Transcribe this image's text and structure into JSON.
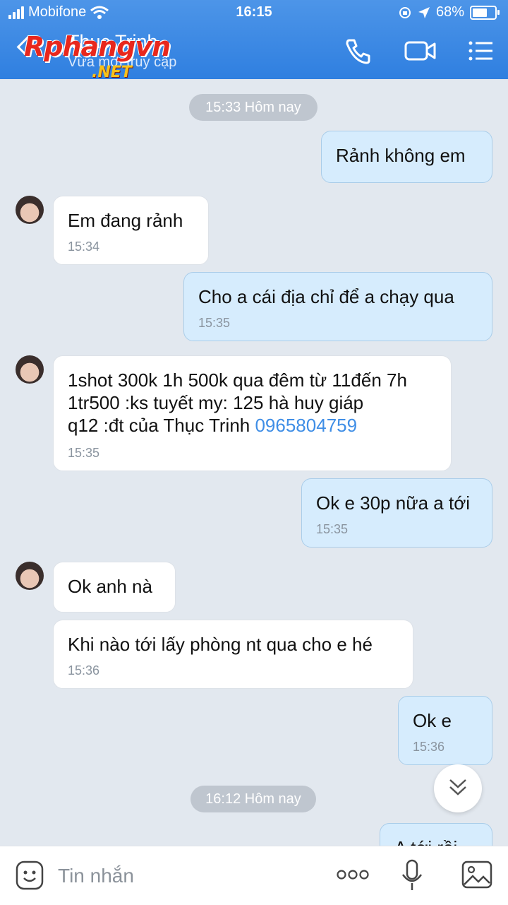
{
  "status_bar": {
    "carrier": "Mobifone",
    "time": "16:15",
    "battery": "68%"
  },
  "header": {
    "contact_name": "Thục Trinh",
    "presence": "Vừa mới truy cập",
    "watermark_main": "Rphangvn",
    "watermark_sub": ".NET"
  },
  "icons": {
    "back": "chevron-left-icon",
    "call": "phone-icon",
    "video": "video-call-icon",
    "menu": "list-menu-icon",
    "sticker": "emoji-icon",
    "more": "more-dots-icon",
    "mic": "microphone-icon",
    "image": "image-icon",
    "scroll": "double-chevron-down-icon"
  },
  "chat": {
    "date1": "15:33 Hôm nay",
    "date2": "16:12 Hôm nay",
    "m1": {
      "text": "Rảnh không em"
    },
    "m2": {
      "text": "Em đang rảnh",
      "time": "15:34"
    },
    "m3": {
      "text": "Cho a cái địa chỉ để a chạy qua",
      "time": "15:35"
    },
    "m4": {
      "text": "1shot 300k 1h 500k qua đêm từ 11đến 7h\n1tr500 :ks tuyết my: 125 hà huy giáp\nq12 :đt của Thục Trinh ",
      "phone": "0965804759",
      "time": "15:35"
    },
    "m5": {
      "text": "Ok e 30p nữa a tới",
      "time": "15:35"
    },
    "m6": {
      "text": "Ok anh nà"
    },
    "m7": {
      "text": "Khi nào tới lấy phòng nt qua cho e hé",
      "time": "15:36"
    },
    "m8": {
      "text": "Ok e",
      "time": "15:36"
    },
    "m9": {
      "text": "A tới rồi"
    }
  },
  "composer": {
    "placeholder": "Tin nhắn"
  },
  "colors": {
    "header": "#2f7fe0",
    "outgoing_bubble": "#d6ecfd",
    "incoming_bubble": "#ffffff",
    "chat_background": "#e2e8ef",
    "link": "#3f8ee6"
  }
}
